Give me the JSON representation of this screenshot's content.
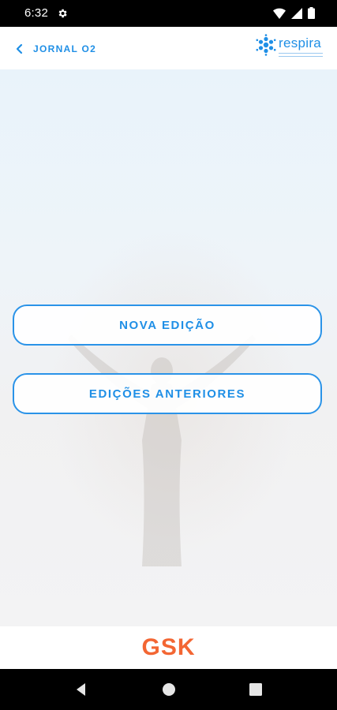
{
  "status_bar": {
    "time": "6:32",
    "icons": [
      "gear-icon",
      "wifi-icon",
      "signal-icon",
      "battery-icon"
    ]
  },
  "header": {
    "back_icon": "chevron-left-icon",
    "title": "JORNAL O2",
    "logo_text": "respira",
    "accent_color": "#1f8fe6"
  },
  "main": {
    "buttons": [
      {
        "label": "NOVA EDIÇÃO"
      },
      {
        "label": "EDIÇÕES ANTERIORES"
      }
    ]
  },
  "footer": {
    "brand": "GSK",
    "brand_color": "#f36633"
  },
  "nav_bar": {
    "icons": [
      "back-triangle-icon",
      "home-circle-icon",
      "recents-square-icon"
    ]
  }
}
